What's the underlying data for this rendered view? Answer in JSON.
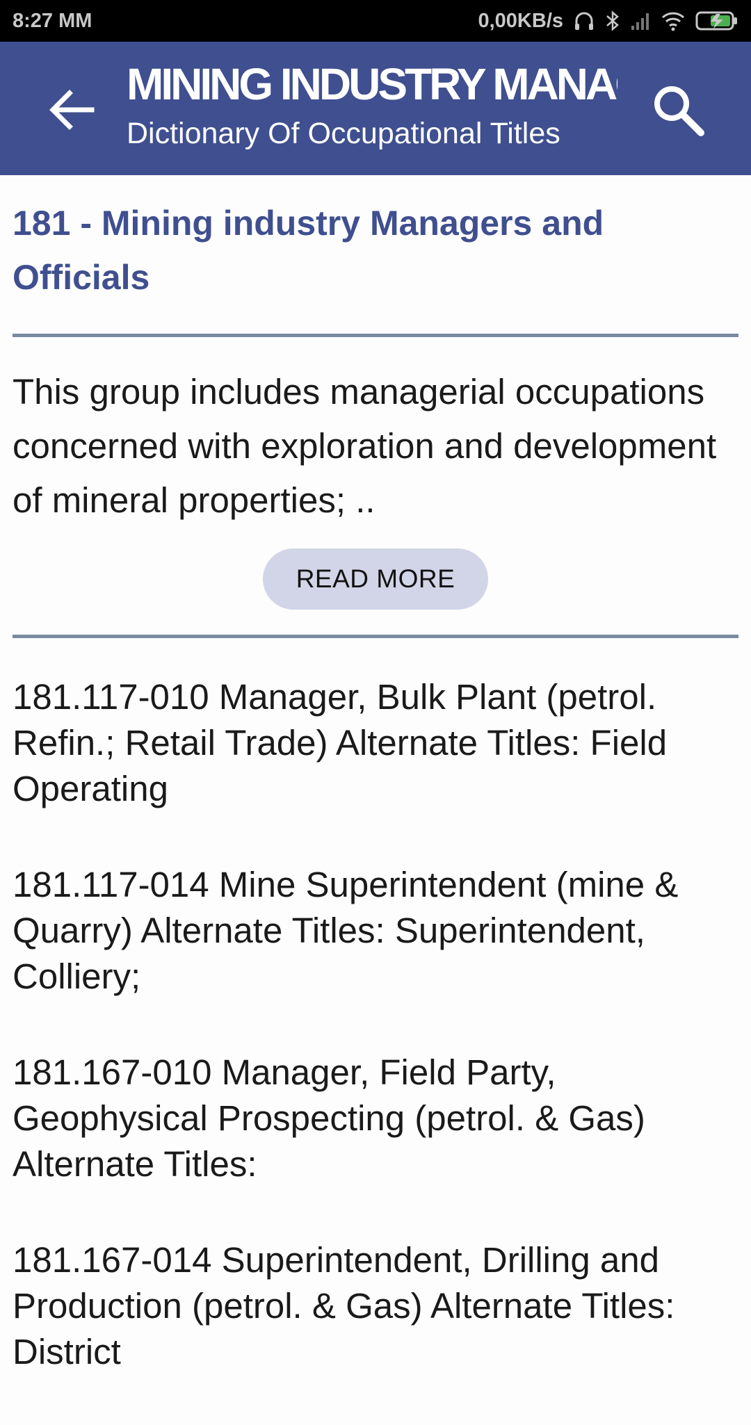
{
  "status_bar": {
    "time": "8:27 MM",
    "network_speed": "0,00KB/s",
    "icons": [
      "headphones-icon",
      "bluetooth-icon",
      "signal-icon",
      "wifi-icon",
      "battery-charging-icon"
    ]
  },
  "app_bar": {
    "title": "MINING INDUSTRY MANAGERS AND OFFICIALS",
    "subtitle": "Dictionary Of Occupational Titles",
    "back_icon": "arrow-left-icon",
    "search_icon": "search-icon"
  },
  "group": {
    "title": "181 - Mining industry Managers and Officials",
    "description": "This group includes managerial occupations concerned with exploration and development of mineral properties; ..",
    "read_more_label": "READ MORE"
  },
  "items": [
    {
      "text": "181.117-010 Manager, Bulk Plant (petrol. Refin.; Retail Trade) Alternate Titles: Field Operating"
    },
    {
      "text": "181.117-014 Mine Superintendent (mine & Quarry) Alternate Titles: Superintendent, Colliery;"
    },
    {
      "text": "181.167-010 Manager, Field Party, Geophysical Prospecting (petrol. & Gas) Alternate Titles:"
    },
    {
      "text": "181.167-014 Superintendent, Drilling and Production (petrol. & Gas) Alternate Titles: District"
    }
  ],
  "colors": {
    "app_bar": "#3f4f8f",
    "accent_text": "#3f4f8f",
    "divider": "#7a8aa0",
    "button_bg": "#d2d5e7"
  }
}
